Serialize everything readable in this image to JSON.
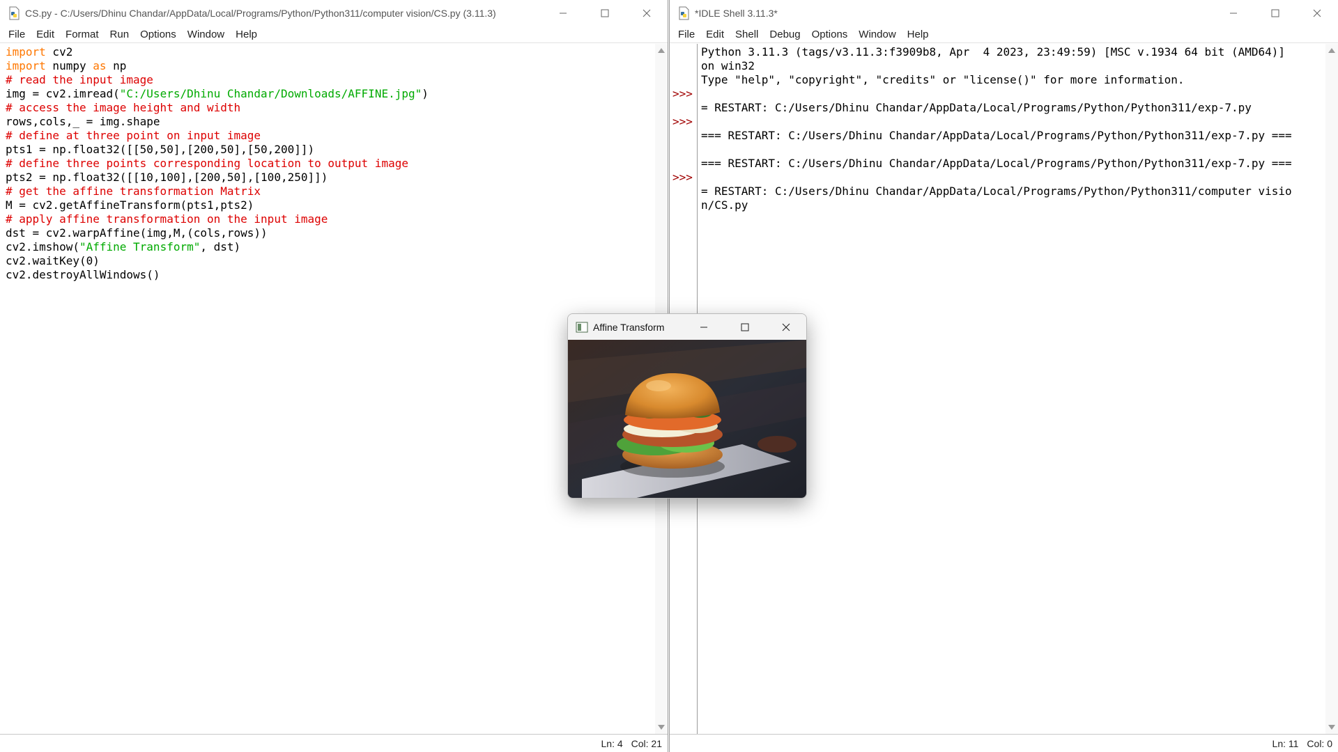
{
  "editor": {
    "title": "CS.py - C:/Users/Dhinu Chandar/AppData/Local/Programs/Python/Python311/computer vision/CS.py (3.11.3)",
    "menu": [
      "File",
      "Edit",
      "Format",
      "Run",
      "Options",
      "Window",
      "Help"
    ],
    "code_lines": [
      [
        {
          "t": "import",
          "c": "kw"
        },
        {
          "t": " cv2",
          "c": ""
        }
      ],
      [
        {
          "t": "import",
          "c": "kw"
        },
        {
          "t": " numpy ",
          "c": ""
        },
        {
          "t": "as",
          "c": "kw"
        },
        {
          "t": " np",
          "c": ""
        }
      ],
      [
        {
          "t": "# read the input image",
          "c": "cm"
        }
      ],
      [
        {
          "t": "img = cv2.imread(",
          "c": ""
        },
        {
          "t": "\"C:/Users/Dhinu Chandar/Downloads/AFFINE.jpg\"",
          "c": "st"
        },
        {
          "t": ")",
          "c": ""
        }
      ],
      [
        {
          "t": "# access the image height and width",
          "c": "cm"
        }
      ],
      [
        {
          "t": "rows,cols,_ = img.shape",
          "c": ""
        }
      ],
      [
        {
          "t": "# define at three point on input image",
          "c": "cm"
        }
      ],
      [
        {
          "t": "pts1 = np.float32([[50,50],[200,50],[50,200]])",
          "c": ""
        }
      ],
      [
        {
          "t": "# define three points corresponding location to output image",
          "c": "cm"
        }
      ],
      [
        {
          "t": "pts2 = np.float32([[10,100],[200,50],[100,250]])",
          "c": ""
        }
      ],
      [
        {
          "t": "# get the affine transformation Matrix",
          "c": "cm"
        }
      ],
      [
        {
          "t": "M = cv2.getAffineTransform(pts1,pts2)",
          "c": ""
        }
      ],
      [
        {
          "t": "# apply affine transformation on the input image",
          "c": "cm"
        }
      ],
      [
        {
          "t": "dst = cv2.warpAffine(img,M,(cols,rows))",
          "c": ""
        }
      ],
      [
        {
          "t": "cv2.imshow(",
          "c": ""
        },
        {
          "t": "\"Affine Transform\"",
          "c": "st"
        },
        {
          "t": ", dst)",
          "c": ""
        }
      ],
      [
        {
          "t": "cv2.waitKey(0)",
          "c": ""
        }
      ],
      [
        {
          "t": "cv2.destroyAllWindows()",
          "c": ""
        }
      ]
    ],
    "status": {
      "ln": "Ln: 4",
      "col": "Col: 21"
    }
  },
  "shell": {
    "title": "*IDLE Shell 3.11.3*",
    "menu": [
      "File",
      "Edit",
      "Shell",
      "Debug",
      "Options",
      "Window",
      "Help"
    ],
    "prompt_symbol": ">>>",
    "prompt_lines": [
      3,
      5,
      9
    ],
    "lines": [
      "Python 3.11.3 (tags/v3.11.3:f3909b8, Apr  4 2023, 23:49:59) [MSC v.1934 64 bit (AMD64)]",
      "on win32",
      "Type \"help\", \"copyright\", \"credits\" or \"license()\" for more information.",
      "",
      "= RESTART: C:/Users/Dhinu Chandar/AppData/Local/Programs/Python/Python311/exp-7.py",
      "",
      "=== RESTART: C:/Users/Dhinu Chandar/AppData/Local/Programs/Python/Python311/exp-7.py ===",
      "",
      "=== RESTART: C:/Users/Dhinu Chandar/AppData/Local/Programs/Python/Python311/exp-7.py ===",
      "",
      "= RESTART: C:/Users/Dhinu Chandar/AppData/Local/Programs/Python/Python311/computer visio",
      "n/CS.py"
    ],
    "status": {
      "ln": "Ln: 11",
      "col": "Col: 0"
    }
  },
  "popup": {
    "title": "Affine Transform",
    "image_icon": "opencv-window-icon",
    "image_subject": "burger-photo"
  },
  "colors": {
    "keyword": "#ff7700",
    "comment": "#dd0000",
    "string": "#00aa00",
    "prompt": "#a00000"
  }
}
